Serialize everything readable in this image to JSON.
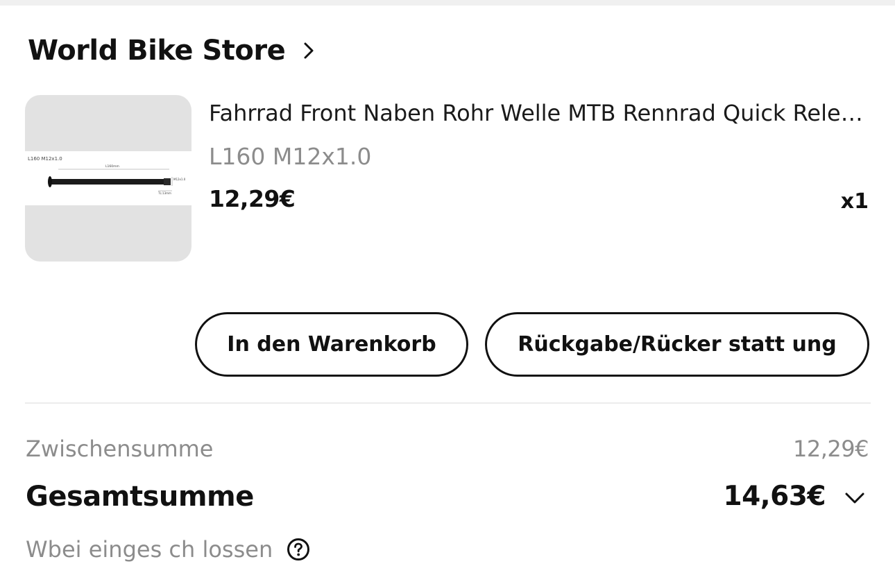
{
  "store": {
    "name": "World Bike Store",
    "chevron_icon": "chevron-right-icon"
  },
  "product": {
    "title": "Fahrrad Front Naben Rohr Welle MTB Rennrad Quick Release Steckachse",
    "variant": "L160 M12x1.0",
    "price": "12,29€",
    "quantity": "x1",
    "image": {
      "caption": "L160 M12x1.0",
      "length_label": "L160mm",
      "thread_label": "M12x1.0",
      "tl_label": "TL:13mm"
    }
  },
  "actions": {
    "add_to_cart": "In den Warenkorb",
    "return_refund": "Rückgabe/Rücker statt ung"
  },
  "summary": {
    "subtotal_label": "Zwischensumme",
    "subtotal_value": "12,29€",
    "total_label": "Gesamtsumme",
    "total_value": "14,63€",
    "fee_label": "Wbei einges ch lossen",
    "help_icon": "help-circle-icon",
    "expand_icon": "chevron-down-icon"
  },
  "colors": {
    "text_primary": "#111111",
    "text_secondary": "#8c8c8c",
    "image_bg": "#e2e2e2",
    "divider": "#ececec"
  }
}
